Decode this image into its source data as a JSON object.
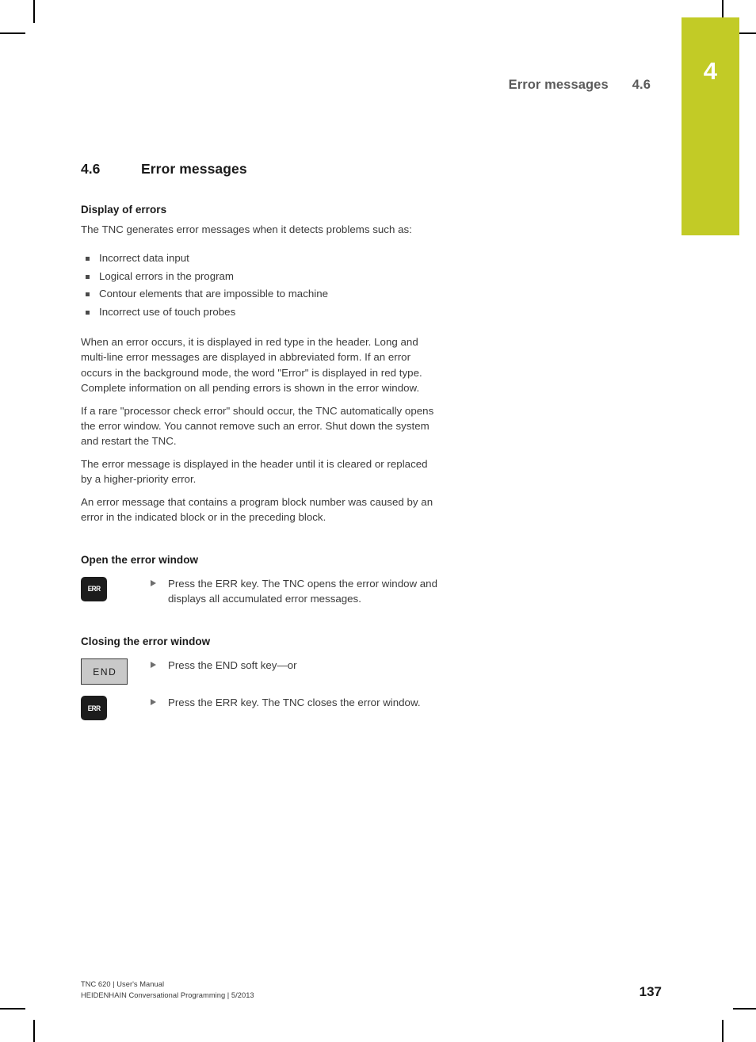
{
  "chapter_tab": {
    "number": "4",
    "color": "#c2cb26"
  },
  "running_header": {
    "title": "Error messages",
    "section_number": "4.6"
  },
  "section": {
    "number": "4.6",
    "title": "Error messages"
  },
  "display_of_errors": {
    "heading": "Display of errors",
    "intro": "The TNC generates error messages when it detects problems such as:",
    "bullets": [
      "Incorrect data input",
      "Logical errors in the program",
      "Contour elements that are impossible to machine",
      "Incorrect use of touch probes"
    ],
    "paragraphs": [
      "When an error occurs, it is displayed in red type in the header. Long and multi-line error messages are displayed in abbreviated form. If an error occurs in the background mode, the word \"Error\" is displayed in red type. Complete information on all pending errors is shown in the error window.",
      "If a rare \"processor check error\" should occur, the TNC automatically opens the error window. You cannot remove such an error. Shut down the system and restart the TNC.",
      "The error message is displayed in the header until it is cleared or replaced by a higher-priority error.",
      "An error message that contains a program block number was caused by an error in the indicated block or in the preceding block."
    ]
  },
  "open_error_window": {
    "heading": "Open the error window",
    "key_label": "ERR",
    "step": "Press the ERR key. The TNC opens the error window and displays all accumulated error messages."
  },
  "closing_error_window": {
    "heading": "Closing the error window",
    "soft_key_label": "END",
    "step_soft": "Press the END soft key—or",
    "hard_key_label": "ERR",
    "step_hard": "Press the ERR key. The TNC closes the error window."
  },
  "footer": {
    "line1": "TNC 620 | User's Manual",
    "line2": "HEIDENHAIN Conversational Programming | 5/2013",
    "page_number": "137"
  }
}
